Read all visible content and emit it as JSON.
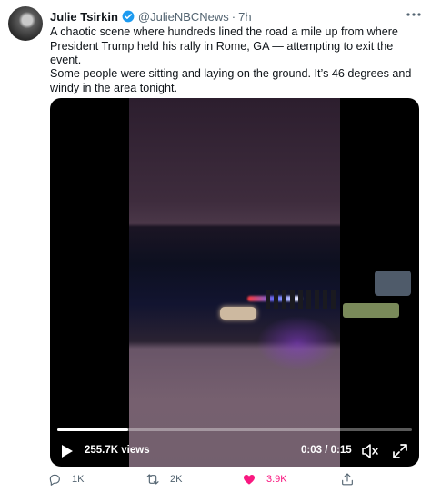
{
  "tweet": {
    "author_name": "Julie Tsirkin",
    "author_handle": "@JulieNBCNews",
    "separator": "·",
    "timestamp": "7h",
    "text_paragraph_1": "A chaotic scene where hundreds lined the road a mile up from where President Trump held his rally in Rome, GA — attempting to exit the event.",
    "text_paragraph_2": "Some people were sitting and laying on the ground. It’s 46 degrees and windy in the area tonight."
  },
  "video": {
    "views": "255.7K views",
    "time_display": "0:03 / 0:15",
    "progress_fraction": 0.2
  },
  "actions": {
    "reply_count": "1K",
    "retweet_count": "2K",
    "like_count": "3.9K"
  },
  "colors": {
    "like": "#f91880",
    "verified": "#1d9bf0",
    "secondary_text": "#536471"
  },
  "icons": [
    "verified-badge-icon",
    "more-icon",
    "play-icon",
    "volume-mute-icon",
    "fullscreen-icon",
    "reply-icon",
    "retweet-icon",
    "like-heart-icon",
    "share-icon"
  ]
}
